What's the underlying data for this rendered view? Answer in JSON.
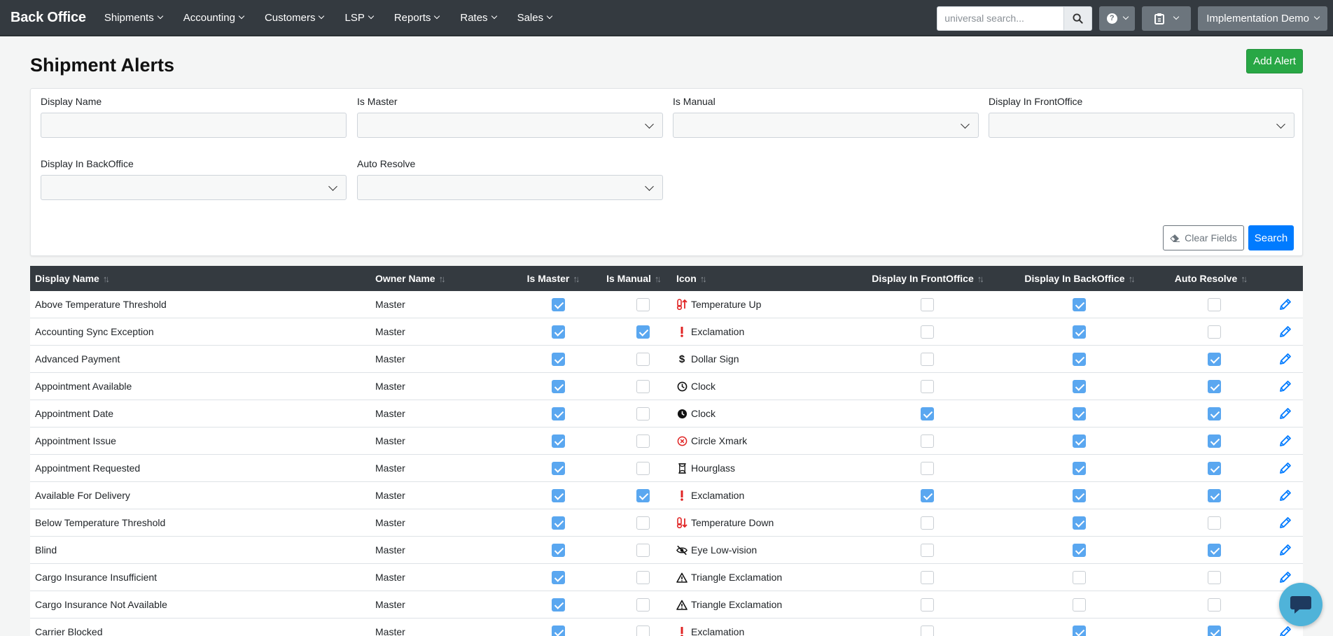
{
  "nav": {
    "brand": "Back Office",
    "items": [
      {
        "label": "Shipments"
      },
      {
        "label": "Accounting"
      },
      {
        "label": "Customers"
      },
      {
        "label": "LSP"
      },
      {
        "label": "Reports"
      },
      {
        "label": "Rates"
      },
      {
        "label": "Sales"
      }
    ],
    "search_placeholder": "universal search...",
    "account_label": "Implementation Demo"
  },
  "page": {
    "title": "Shipment Alerts",
    "add_label": "Add Alert"
  },
  "filters": {
    "fields": [
      {
        "label": "Display Name",
        "type": "text"
      },
      {
        "label": "Is Master",
        "type": "select"
      },
      {
        "label": "Is Manual",
        "type": "select"
      },
      {
        "label": "Display In FrontOffice",
        "type": "select"
      },
      {
        "label": "Display In BackOffice",
        "type": "select"
      },
      {
        "label": "Auto Resolve",
        "type": "select"
      }
    ],
    "clear_label": "Clear Fields",
    "search_label": "Search"
  },
  "table": {
    "headers": [
      "Display Name",
      "Owner Name",
      "Is Master",
      "Is Manual",
      "Icon",
      "Display In FrontOffice",
      "Display In BackOffice",
      "Auto Resolve"
    ],
    "rows": [
      {
        "name": "Above Temperature Threshold",
        "owner": "Master",
        "master": true,
        "manual": false,
        "icon": "temperature-up",
        "icon_label": "Temperature Up",
        "front": false,
        "back": true,
        "auto": false
      },
      {
        "name": "Accounting Sync Exception",
        "owner": "Master",
        "master": true,
        "manual": true,
        "icon": "exclamation",
        "icon_label": "Exclamation",
        "front": false,
        "back": true,
        "auto": false
      },
      {
        "name": "Advanced Payment",
        "owner": "Master",
        "master": true,
        "manual": false,
        "icon": "dollar-sign",
        "icon_label": "Dollar Sign",
        "front": false,
        "back": true,
        "auto": true
      },
      {
        "name": "Appointment Available",
        "owner": "Master",
        "master": true,
        "manual": false,
        "icon": "clock-outline",
        "icon_label": "Clock",
        "front": false,
        "back": true,
        "auto": true
      },
      {
        "name": "Appointment Date",
        "owner": "Master",
        "master": true,
        "manual": false,
        "icon": "clock-solid",
        "icon_label": "Clock",
        "front": true,
        "back": true,
        "auto": true
      },
      {
        "name": "Appointment Issue",
        "owner": "Master",
        "master": true,
        "manual": false,
        "icon": "circle-xmark",
        "icon_label": "Circle Xmark",
        "front": false,
        "back": true,
        "auto": true
      },
      {
        "name": "Appointment Requested",
        "owner": "Master",
        "master": true,
        "manual": false,
        "icon": "hourglass",
        "icon_label": "Hourglass",
        "front": false,
        "back": true,
        "auto": true
      },
      {
        "name": "Available For Delivery",
        "owner": "Master",
        "master": true,
        "manual": true,
        "icon": "exclamation",
        "icon_label": "Exclamation",
        "front": true,
        "back": true,
        "auto": true
      },
      {
        "name": "Below Temperature Threshold",
        "owner": "Master",
        "master": true,
        "manual": false,
        "icon": "temperature-down",
        "icon_label": "Temperature Down",
        "front": false,
        "back": true,
        "auto": false
      },
      {
        "name": "Blind",
        "owner": "Master",
        "master": true,
        "manual": false,
        "icon": "eye-low-vision",
        "icon_label": "Eye Low-vision",
        "front": false,
        "back": true,
        "auto": true
      },
      {
        "name": "Cargo Insurance Insufficient",
        "owner": "Master",
        "master": true,
        "manual": false,
        "icon": "triangle-exclamation",
        "icon_label": "Triangle Exclamation",
        "front": false,
        "back": false,
        "auto": false
      },
      {
        "name": "Cargo Insurance Not Available",
        "owner": "Master",
        "master": true,
        "manual": false,
        "icon": "triangle-exclamation",
        "icon_label": "Triangle Exclamation",
        "front": false,
        "back": false,
        "auto": false
      },
      {
        "name": "Carrier Blocked",
        "owner": "Master",
        "master": true,
        "manual": false,
        "icon": "exclamation",
        "icon_label": "Exclamation",
        "front": false,
        "back": true,
        "auto": true
      }
    ]
  },
  "colors": {
    "navbar": "#343a40",
    "primary": "#007bff",
    "success": "#28a745",
    "checkbox_on": "#5aa7f0",
    "alert_red": "#e02424"
  }
}
